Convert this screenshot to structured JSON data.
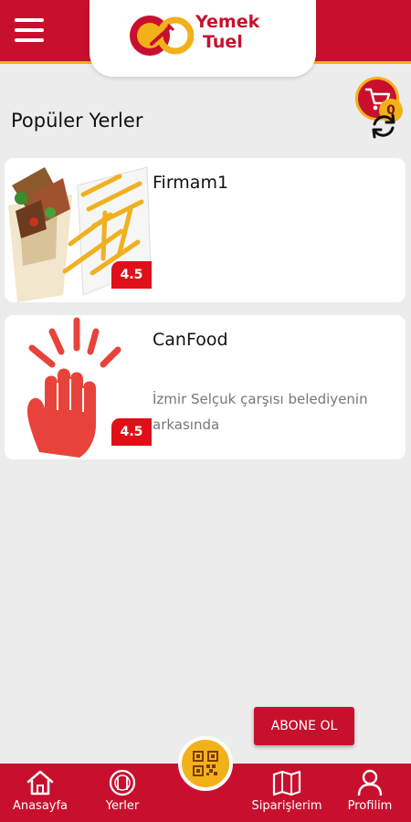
{
  "header": {
    "logo_line1": "Yemek",
    "logo_line2": "Tuel"
  },
  "cart": {
    "count": "0"
  },
  "section": {
    "title": "Popüler Yerler"
  },
  "places": [
    {
      "name": "Firmam1",
      "address": "",
      "rating": "4.5",
      "image": "kebab-fries-image"
    },
    {
      "name": "CanFood",
      "address": "İzmir Selçuk çarşısı belediyenin arkasında",
      "rating": "4.5",
      "image": "clap-hand-image"
    }
  ],
  "subscribe_button": "ABONE OL",
  "bottom_nav": [
    {
      "label": "Anasayfa",
      "icon": "home-icon"
    },
    {
      "label": "Yerler",
      "icon": "restaurant-icon"
    },
    {
      "label": "",
      "icon": "qr-code-icon"
    },
    {
      "label": "Siparişlerim",
      "icon": "map-icon"
    },
    {
      "label": "Profilim",
      "icon": "user-icon"
    }
  ],
  "colors": {
    "primary": "#c8102e",
    "accent": "#f2b11a",
    "rating": "#e01018",
    "background": "#ececec"
  }
}
